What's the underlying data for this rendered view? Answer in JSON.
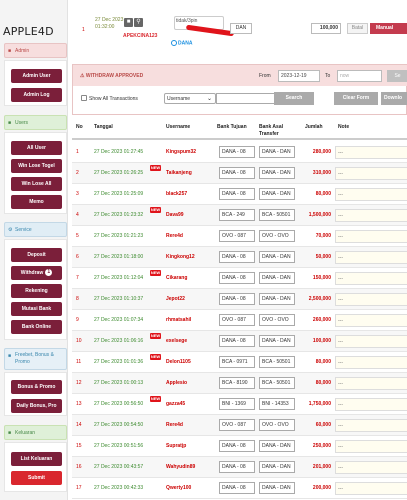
{
  "brand": "APPLE4D",
  "sidebar": {
    "sections": [
      {
        "title": "Admin",
        "buttons": [
          "Admin User",
          "Admin Log"
        ]
      },
      {
        "title": "Users",
        "buttons": [
          "All User",
          "Win Lose Togel",
          "Win Lose All",
          "Memo"
        ]
      },
      {
        "title": "Service",
        "buttons": [
          "Deposit",
          "Withdraw",
          "Rekening",
          "Mutasi Bank",
          "Bank Online"
        ],
        "withdraw_badge": "1"
      },
      {
        "title": "Freebet, Bonus & Promo",
        "buttons": [
          "Bonus & Promo",
          "Daily Bonus, Pro"
        ]
      },
      {
        "title": "Keluaran",
        "buttons": [
          "List Keluaran",
          "Submit"
        ]
      }
    ]
  },
  "top_request": {
    "number": "1",
    "date": "27 Dec 2023 01:32:00",
    "username": "APEKCINA123",
    "account_input": "tidak/3pin",
    "dana_label": "DANA",
    "bank": "DAN",
    "amount": "100,000",
    "batal_label": "Batal",
    "manual_label": "Manual"
  },
  "withdraw_panel": {
    "title": "WITHDRAW APPROVED",
    "from_label": "From",
    "from_value": "2023-12-19",
    "to_label": "To",
    "to_placeholder": "now",
    "search_top_label": "Se",
    "show_all_label": "Show All Transactions",
    "filter_select": "Username",
    "search_label": "Search",
    "clear_label": "Clear Form",
    "download_label": "Downlo"
  },
  "table": {
    "headers": {
      "no": "No",
      "tanggal": "Tanggal",
      "username": "Username",
      "bank_tujuan": "Bank Tujuan",
      "bank_asal": "Bank Asal Transfer",
      "jumlah": "Jumlah",
      "note": "Note"
    },
    "rows": [
      {
        "no": "1",
        "date": "27 Dec 2023 01:27:45",
        "user": "Kingspum32",
        "bank_to": "DANA - 08",
        "bank_from": "DANA - DAN",
        "amount": "280,000",
        "note": "---",
        "new": false
      },
      {
        "no": "2",
        "date": "27 Dec 2023 01:26:25",
        "user": "Taikanjeng",
        "bank_to": "DANA - 08",
        "bank_from": "DANA - DAN",
        "amount": "310,000",
        "note": "---",
        "new": true
      },
      {
        "no": "3",
        "date": "27 Dec 2023 01:25:09",
        "user": "black257",
        "bank_to": "DANA - 08",
        "bank_from": "DANA - DAN",
        "amount": "80,000",
        "note": "---",
        "new": false
      },
      {
        "no": "4",
        "date": "27 Dec 2023 01:23:32",
        "user": "Dava99",
        "bank_to": "BCA - 249",
        "bank_from": "BCA - 50501",
        "amount": "1,500,000",
        "note": "---",
        "new": true
      },
      {
        "no": "5",
        "date": "27 Dec 2023 01:21:23",
        "user": "Rere4d",
        "bank_to": "OVO - 087",
        "bank_from": "OVO - OVO",
        "amount": "70,000",
        "note": "---",
        "new": false
      },
      {
        "no": "6",
        "date": "27 Dec 2023 01:18:00",
        "user": "Kingkong12",
        "bank_to": "DANA - 08",
        "bank_from": "DANA - DAN",
        "amount": "50,000",
        "note": "---",
        "new": false
      },
      {
        "no": "7",
        "date": "27 Dec 2023 01:12:04",
        "user": "Cikarang",
        "bank_to": "DANA - 08",
        "bank_from": "DANA - DAN",
        "amount": "150,000",
        "note": "---",
        "new": true
      },
      {
        "no": "8",
        "date": "27 Dec 2023 01:10:37",
        "user": "Jepot22",
        "bank_to": "DANA - 08",
        "bank_from": "DANA - DAN",
        "amount": "2,500,000",
        "note": "---",
        "new": false
      },
      {
        "no": "9",
        "date": "27 Dec 2023 01:07:34",
        "user": "rhmatsahil",
        "bank_to": "OVO - 087",
        "bank_from": "OVO - OVO",
        "amount": "260,000",
        "note": "---",
        "new": false
      },
      {
        "no": "10",
        "date": "27 Dec 2023 01:06:16",
        "user": "exelsege",
        "bank_to": "DANA - 08",
        "bank_from": "DANA - DAN",
        "amount": "100,000",
        "note": "---",
        "new": true
      },
      {
        "no": "11",
        "date": "27 Dec 2023 01:01:36",
        "user": "Delon1105",
        "bank_to": "BCA - 0971",
        "bank_from": "BCA - 50501",
        "amount": "80,000",
        "note": "---",
        "new": true
      },
      {
        "no": "12",
        "date": "27 Dec 2023 01:00:13",
        "user": "Applesio",
        "bank_to": "BCA - 8190",
        "bank_from": "BCA - 50501",
        "amount": "80,000",
        "note": "---",
        "new": false
      },
      {
        "no": "13",
        "date": "27 Dec 2023 00:56:50",
        "user": "gazza45",
        "bank_to": "BNI - 1369",
        "bank_from": "BNI - 14353",
        "amount": "1,750,000",
        "note": "---",
        "new": true
      },
      {
        "no": "14",
        "date": "27 Dec 2023 00:54:50",
        "user": "Rere4d",
        "bank_to": "OVO - 087",
        "bank_from": "OVO - OVO",
        "amount": "60,000",
        "note": "---",
        "new": false
      },
      {
        "no": "15",
        "date": "27 Dec 2023 00:51:56",
        "user": "Supratjp",
        "bank_to": "DANA - 08",
        "bank_from": "DANA - DAN",
        "amount": "250,000",
        "note": "---",
        "new": false
      },
      {
        "no": "16",
        "date": "27 Dec 2023 00:43:57",
        "user": "Wahyudin89",
        "bank_to": "DANA - 08",
        "bank_from": "DANA - DAN",
        "amount": "201,000",
        "note": "---",
        "new": false
      },
      {
        "no": "17",
        "date": "27 Dec 2023 00:42:33",
        "user": "Qwerty100",
        "bank_to": "DANA - 08",
        "bank_from": "DANA - DAN",
        "amount": "200,000",
        "note": "---",
        "new": false
      }
    ]
  },
  "colors": {
    "nav_button": "#7b1f3a",
    "submit_button": "#d9272e",
    "username_text": "#cc0000",
    "date_text": "#3c8a2e"
  }
}
